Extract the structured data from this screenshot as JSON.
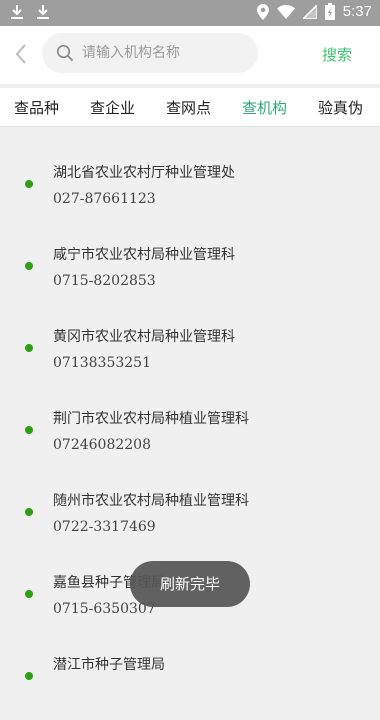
{
  "status_bar": {
    "time": "5:37",
    "icons": [
      "download-icon",
      "download-icon",
      "location-icon",
      "wifi-icon",
      "signal-icon",
      "battery-icon"
    ]
  },
  "header": {
    "back_icon": "chevron-left-icon",
    "search_icon": "search-icon",
    "search_placeholder": "请输入机构名称",
    "search_value": "",
    "search_button": "搜索"
  },
  "tabs": [
    {
      "label": "查品种",
      "active": false
    },
    {
      "label": "查企业",
      "active": false
    },
    {
      "label": "查网点",
      "active": false
    },
    {
      "label": "查机构",
      "active": true
    },
    {
      "label": "验真伪",
      "active": false
    }
  ],
  "list": [
    {
      "name": "湖北省农业农村厅种业管理处",
      "phone": "027-87661123"
    },
    {
      "name": "咸宁市农业农村局种业管理科",
      "phone": "0715-8202853"
    },
    {
      "name": "黄冈市农业农村局种业管理科",
      "phone": "07138353251"
    },
    {
      "name": "荆门市农业农村局种植业管理科",
      "phone": "07246082208"
    },
    {
      "name": "随州市农业农村局种植业管理科",
      "phone": "0722-3317469"
    },
    {
      "name": "嘉鱼县种子管理局",
      "phone": "0715-6350307"
    },
    {
      "name": "潜江市种子管理局",
      "phone": ""
    }
  ],
  "toast": "刷新完毕",
  "colors": {
    "accent": "#2fa77a",
    "search_button": "#3cc470",
    "dot": "#2f9e12",
    "status_bar": "#9e9e9e"
  }
}
